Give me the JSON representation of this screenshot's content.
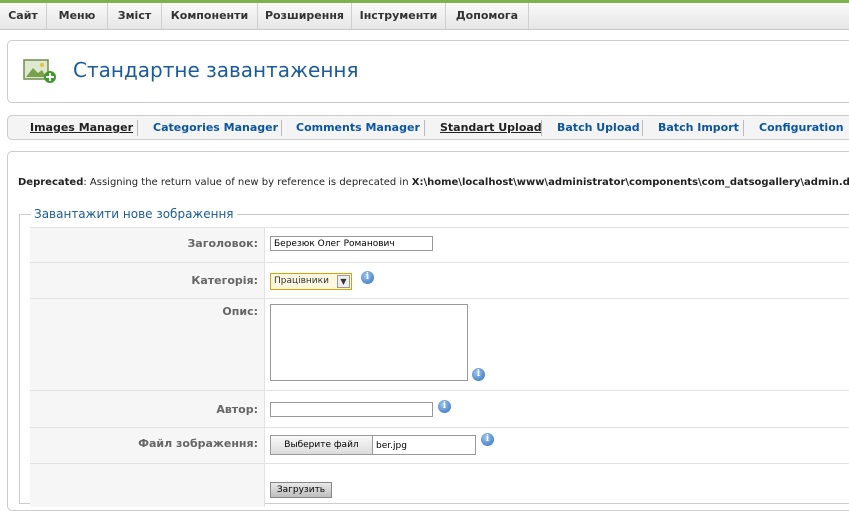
{
  "top_menu": [
    "Сайт",
    "Меню",
    "Зміст",
    "Компоненти",
    "Розширення",
    "Інструменти",
    "Допомога"
  ],
  "page_title": "Стандартне завантаження",
  "sub_menu": [
    "Images Manager",
    "Categories Manager",
    "Comments Manager",
    "Standart Upload",
    "Batch Upload",
    "Batch Import",
    "Configuration"
  ],
  "notice": {
    "label": "Deprecated",
    "text": ": Assigning the return value of new by reference is deprecated in ",
    "path": "X:\\home\\localhost\\www\\administrator\\components\\com_datsogallery\\admin.datso"
  },
  "form": {
    "legend": "Завантажити нове зображення",
    "title_label": "Заголовок:",
    "title_value": "Березюк Олег Романович",
    "category_label": "Категорія:",
    "category_value": "Працівники",
    "description_label": "Опис:",
    "author_label": "Автор:",
    "author_value": "",
    "file_label": "Файл зображення:",
    "file_button": "Выберите файл",
    "file_name": "ber.jpg",
    "submit_label": "Загрузить"
  },
  "colors": {
    "accent": "#1a5b9c",
    "link": "#0b55a4",
    "topline": "#7fb24a"
  },
  "icons": [
    "image-upload-icon",
    "info-icon",
    "select-arrow-icon"
  ]
}
